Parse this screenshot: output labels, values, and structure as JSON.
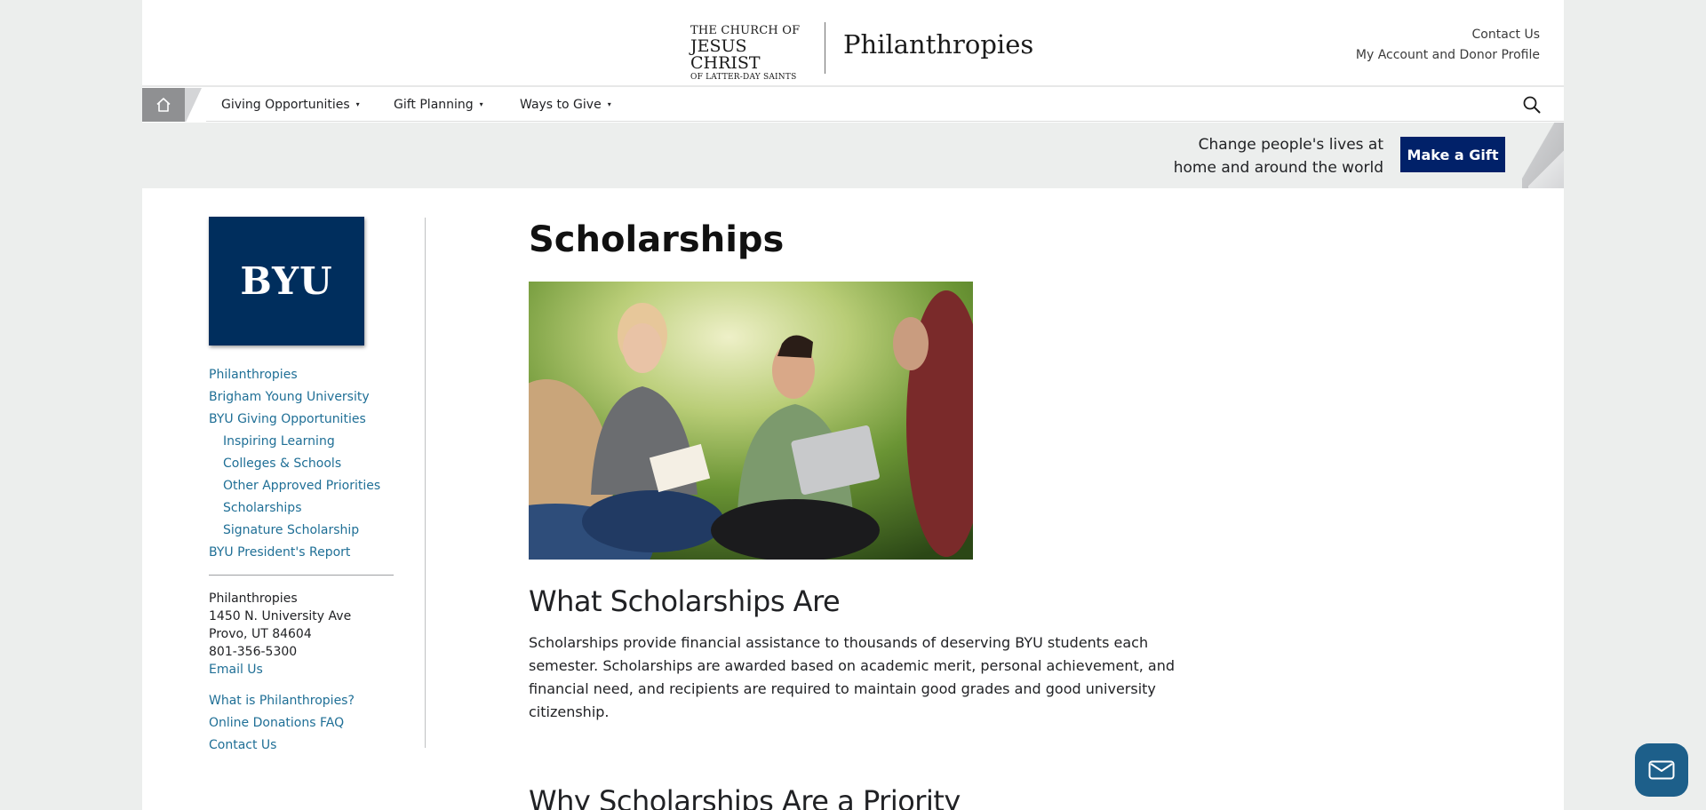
{
  "header": {
    "church_logo": {
      "line1": "THE CHURCH OF",
      "line2": "JESUS CHRIST",
      "line3": "OF LATTER-DAY SAINTS"
    },
    "site_name": "Philanthropies",
    "links": [
      "Contact Us",
      "My Account and Donor Profile"
    ]
  },
  "nav": {
    "items": [
      "Giving Opportunities",
      "Gift Planning",
      "Ways to Give"
    ],
    "caret": "▾"
  },
  "banner": {
    "line1": "Change people's lives at",
    "line2": "home and around the world",
    "cta": "Make a Gift"
  },
  "sidebar": {
    "logo_text": "BYU",
    "links": [
      {
        "label": "Philanthropies"
      },
      {
        "label": "Brigham Young University"
      },
      {
        "label": "BYU Giving Opportunities"
      },
      {
        "label": "Inspiring Learning"
      },
      {
        "label": "Colleges & Schools"
      },
      {
        "label": "Other Approved Priorities"
      },
      {
        "label": "Scholarships"
      },
      {
        "label": "Signature Scholarship"
      },
      {
        "label": "BYU President's Report"
      }
    ],
    "address": {
      "name": "Philanthropies",
      "street": "1450 N. University Ave",
      "city": "Provo, UT 84604",
      "phone": "801-356-5300",
      "email": "Email Us"
    },
    "links2": [
      "What is Philanthropies?",
      "Online Donations FAQ",
      "Contact Us"
    ]
  },
  "main": {
    "title": "Scholarships",
    "section1_heading": "What Scholarships Are",
    "section1_body": "Scholarships provide financial assistance to thousands of deserving BYU students each semester. Scholarships are awarded based on academic merit, personal achievement, and financial need, and recipients are required to maintain good grades and good university citizenship.",
    "section2_heading": "Why Scholarships Are a Priority"
  },
  "colors": {
    "brand_navy": "#002e5d",
    "button_navy": "#012169",
    "link_blue": "#1f6f96",
    "chat_blue": "#1d5f8a"
  },
  "icons": [
    "home-icon",
    "search-icon",
    "chat-mail-icon"
  ]
}
